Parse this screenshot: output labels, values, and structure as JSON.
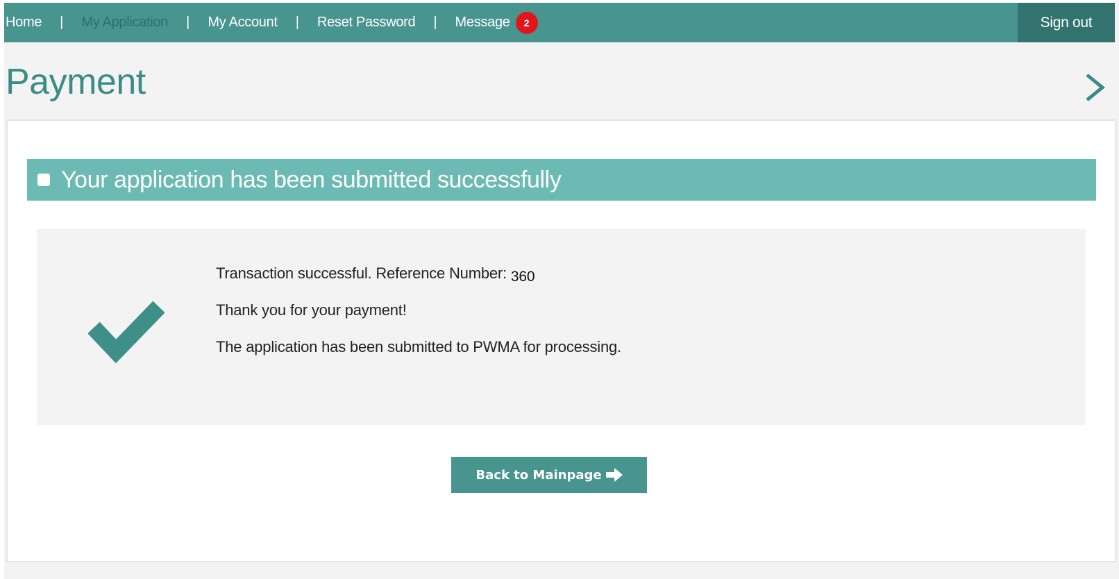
{
  "nav": {
    "links": [
      "Home",
      "My Application",
      "My Account",
      "Reset Password",
      "Message"
    ],
    "separator": "|",
    "message_count": "2",
    "sign_out": "Sign out"
  },
  "page": {
    "title": "Payment"
  },
  "banner": {
    "text": "Your application has been submitted successfully"
  },
  "result": {
    "line1": "Transaction successful. Reference Number:",
    "reference_number": "360",
    "line2": "Thank you for your payment!",
    "line3": "The application has been submitted to PWMA for processing."
  },
  "actions": {
    "back_label": "Back to Mainpage"
  },
  "colors": {
    "nav_bg": "#48948f",
    "sign_out_bg": "#33736f",
    "accent": "#3a8c87",
    "banner_bg": "#6bbab3",
    "badge": "#e0161d"
  },
  "icons": [
    "chevron-right-icon",
    "check-icon",
    "arrow-right-icon"
  ]
}
